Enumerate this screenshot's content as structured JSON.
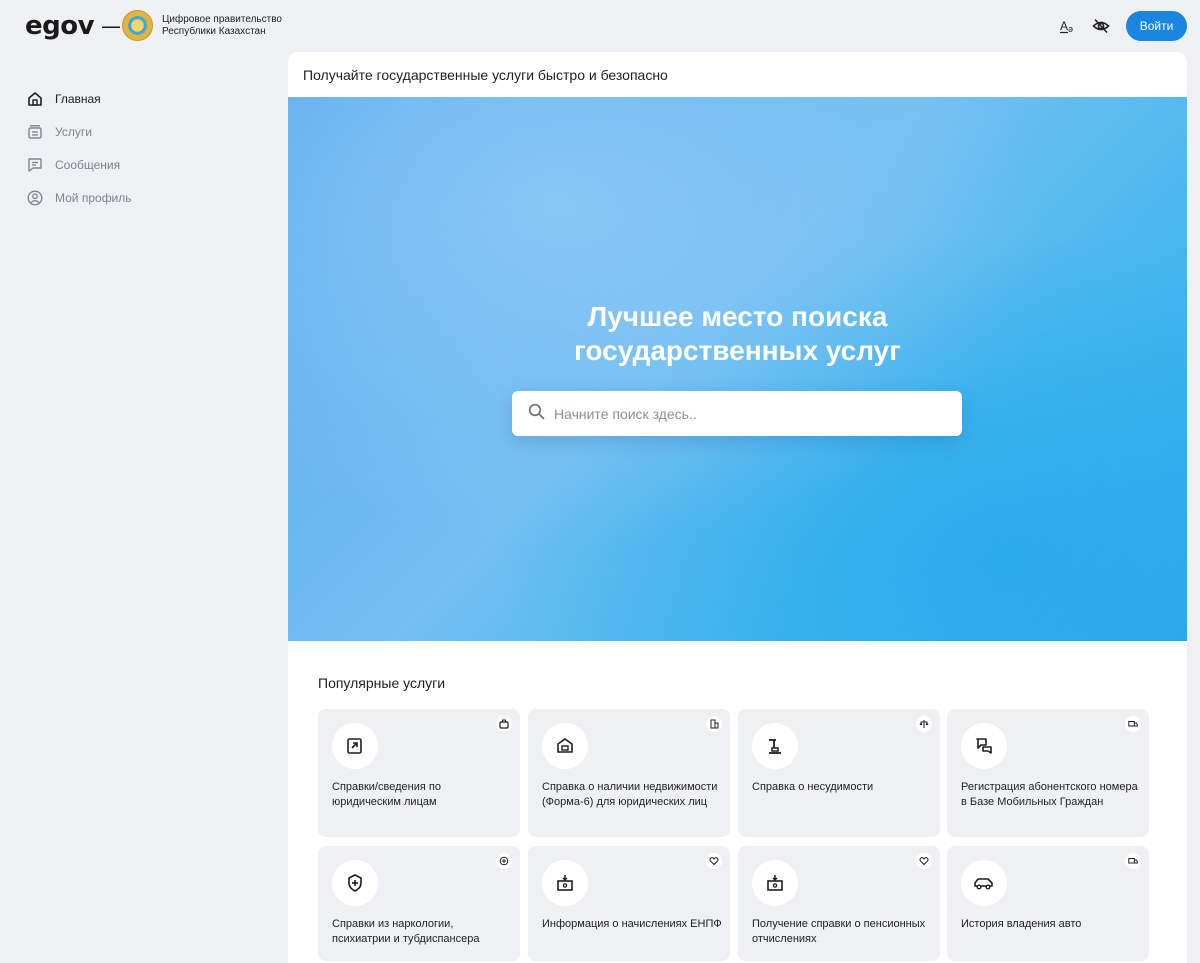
{
  "header": {
    "logo": "egov",
    "separator": "—",
    "gov_name_line1": "Цифровое правительство",
    "gov_name_line2": "Республики Казахстан",
    "login_label": "Войти",
    "icons": [
      "font-size-icon",
      "eye-off-icon"
    ]
  },
  "sidebar": {
    "items": [
      {
        "label": "Главная",
        "icon": "home-icon",
        "active": true
      },
      {
        "label": "Услуги",
        "icon": "services-icon",
        "active": false
      },
      {
        "label": "Сообщения",
        "icon": "messages-icon",
        "active": false
      },
      {
        "label": "Мой профиль",
        "icon": "profile-icon",
        "active": false
      }
    ]
  },
  "main": {
    "header_text": "Получайте государственные услуги быстро и безопасно",
    "hero_title_line1": "Лучшее место поиска",
    "hero_title_line2": "государственных услуг",
    "search_placeholder": "Начните поиск здесь..",
    "popular_title": "Популярные услуги",
    "services": [
      {
        "title": "Справки/сведения по юридическим лицам",
        "icon": "document-icon",
        "category_icon": "briefcase-icon"
      },
      {
        "title": "Справка о наличии недвижимости (Форма-6) для юридических лиц",
        "icon": "house-icon",
        "category_icon": "building-icon"
      },
      {
        "title": "Справка о несудимости",
        "icon": "gavel-icon",
        "category_icon": "scales-icon"
      },
      {
        "title": "Регистрация абонентского номера в Базе Мобильных Граждан",
        "icon": "chat-icon",
        "category_icon": "truck-icon"
      },
      {
        "title": "Справки из наркологии, психиатрии и тубдиспансера",
        "icon": "shield-plus-icon",
        "category_icon": "plus-icon"
      },
      {
        "title": "Информация о начислениях ЕНПФ",
        "icon": "cash-box-icon",
        "category_icon": "heart-icon"
      },
      {
        "title": "Получение справки о пенсионных отчислениях",
        "icon": "cash-box-icon",
        "category_icon": "heart-icon"
      },
      {
        "title": "История владения авто",
        "icon": "car-icon",
        "category_icon": "truck-icon"
      }
    ]
  },
  "colors": {
    "accent": "#1a86e0",
    "page_bg": "#eef0f3",
    "card_bg": "#eef0f3"
  }
}
